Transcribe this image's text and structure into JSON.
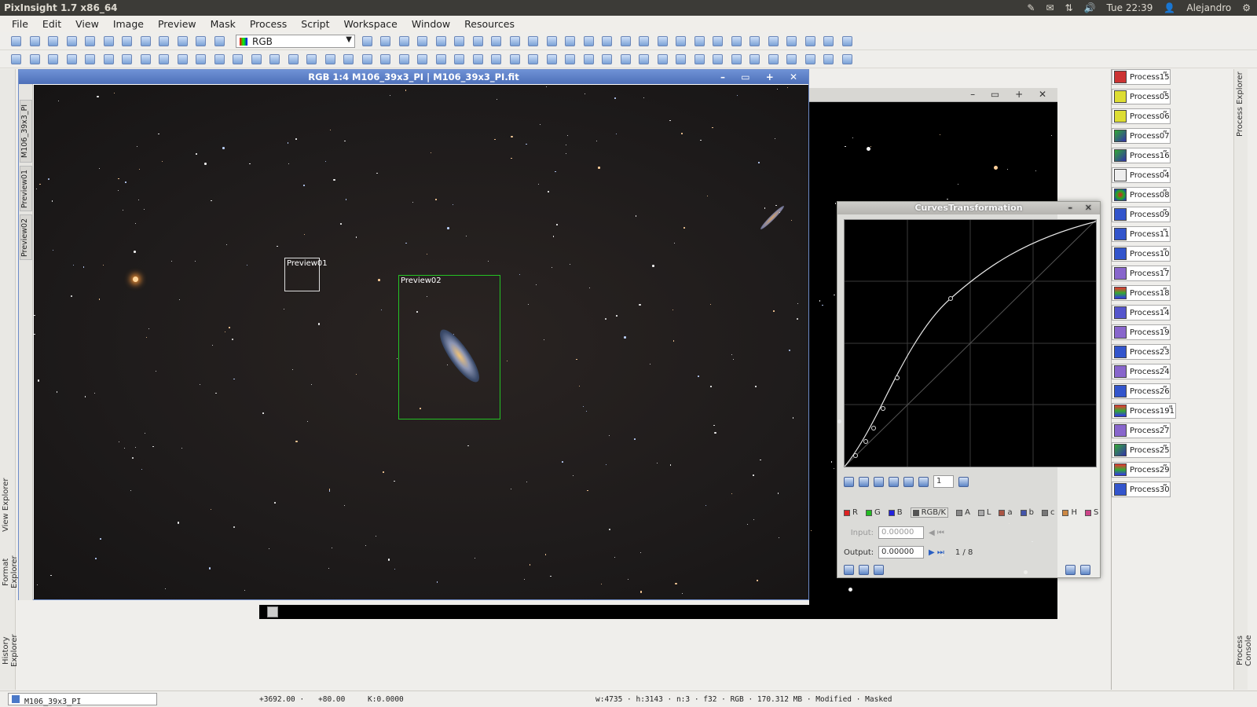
{
  "app": {
    "title": "PixInsight 1.7 x86_64",
    "clock": "Tue 22:39",
    "user": "Alejandro"
  },
  "menu": [
    "File",
    "Edit",
    "View",
    "Image",
    "Preview",
    "Mask",
    "Process",
    "Script",
    "Workspace",
    "Window",
    "Resources"
  ],
  "toolbar": {
    "channel_select": "RGB"
  },
  "image_window": {
    "title": "RGB 1:4 M106_39x3_PI | M106_39x3_PI.fit",
    "side_tabs": [
      "M106_39x3_PI",
      "Preview01",
      "Preview02"
    ],
    "previews": [
      {
        "label": "Preview01"
      },
      {
        "label": "Preview02"
      }
    ]
  },
  "left_dock": {
    "tabs": [
      "View Explorer",
      "Format Explorer",
      "History Explorer"
    ]
  },
  "right_dock": {
    "tabs": [
      "Process Explorer",
      "Process Console"
    ]
  },
  "curves": {
    "title": "CurvesTransformation",
    "zoom_value": "1",
    "channels": [
      "R",
      "G",
      "B",
      "RGB/K",
      "A",
      "L",
      "a",
      "b",
      "c",
      "H",
      "S"
    ],
    "active_channel": "RGB/K",
    "input_label": "Input:",
    "input_value": "0.00000",
    "output_label": "Output:",
    "output_value": "0.00000",
    "point_counter": "1 / 8"
  },
  "process_icons": [
    "Process15",
    "Process05",
    "Process06",
    "Process07",
    "Process16",
    "Process04",
    "Process08",
    "Process09",
    "Process11",
    "Process10",
    "Process17",
    "Process18",
    "Process14",
    "Process19",
    "Process23",
    "Process24",
    "Process26",
    "Process191",
    "Process27",
    "Process25",
    "Process29",
    "Process30"
  ],
  "status": {
    "view": "M106_39x3_PI",
    "x": "+3692.00 ·",
    "y": "+80.00",
    "k": "K:0.0000",
    "info": "w:4735 · h:3143 · n:3 · f32 · RGB · 170.312 MB · Modified · Masked"
  }
}
